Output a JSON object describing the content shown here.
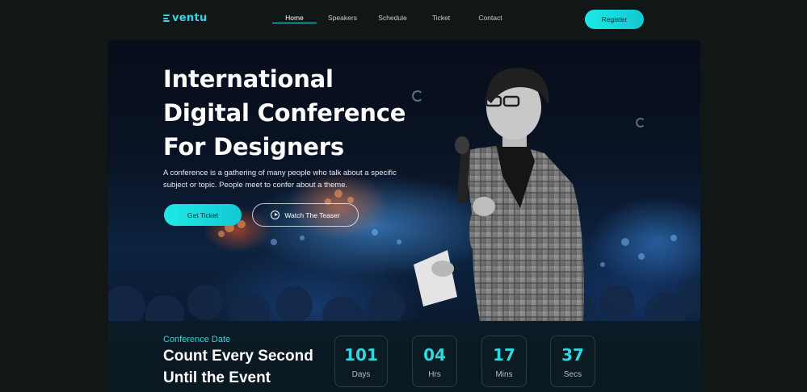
{
  "nav": {
    "logo": "ventu",
    "links": [
      "Home",
      "Speakers",
      "Schedule",
      "Ticket",
      "Contact"
    ],
    "active": "Home",
    "register_label": "Register"
  },
  "hero": {
    "title_lines": [
      "International",
      "Digital Conference",
      "For Designers"
    ],
    "description_lines": [
      "A conference is a gathering of many people who talk about a specific",
      "subject or topic. People meet to confer about a theme."
    ],
    "ticket_label": "Get Ticket",
    "teaser_label": "Watch The Teaser"
  },
  "countdown": {
    "label": "Conference Date",
    "heading_lines": [
      "Count Every Second",
      "Until the Event"
    ],
    "items": [
      {
        "value": "101",
        "unit": "Days"
      },
      {
        "value": "04",
        "unit": "Hrs"
      },
      {
        "value": "17",
        "unit": "Mins"
      },
      {
        "value": "37",
        "unit": "Secs"
      }
    ]
  },
  "colors": {
    "accent": "#2fd7e0",
    "background": "#111717"
  }
}
